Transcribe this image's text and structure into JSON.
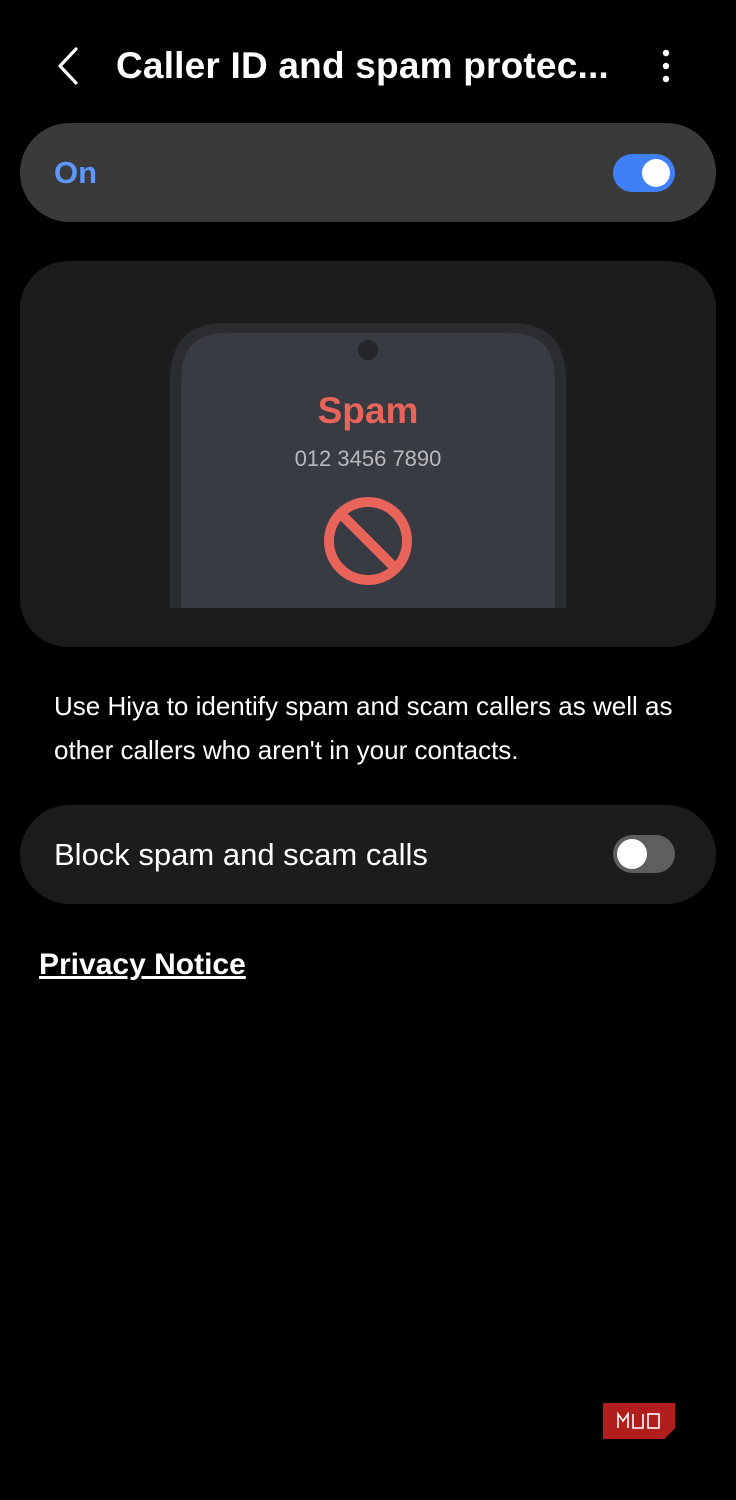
{
  "header": {
    "title": "Caller ID and spam protec...",
    "back_icon": "chevron-left-icon",
    "more_icon": "more-vertical-icon"
  },
  "master_switch": {
    "label": "On",
    "enabled": true
  },
  "illustration": {
    "caller_label": "Spam",
    "phone_number": "012 3456 7890",
    "block_icon": "block-icon"
  },
  "description": "Use Hiya to identify spam and scam callers as well as other callers who aren't in your contacts.",
  "block_setting": {
    "label": "Block spam and scam calls",
    "enabled": false
  },
  "privacy_link": "Privacy Notice",
  "colors": {
    "background": "#000000",
    "accent": "#5d97ff",
    "toggle_on": "#3f80f6",
    "spam_red": "#e8645a"
  }
}
